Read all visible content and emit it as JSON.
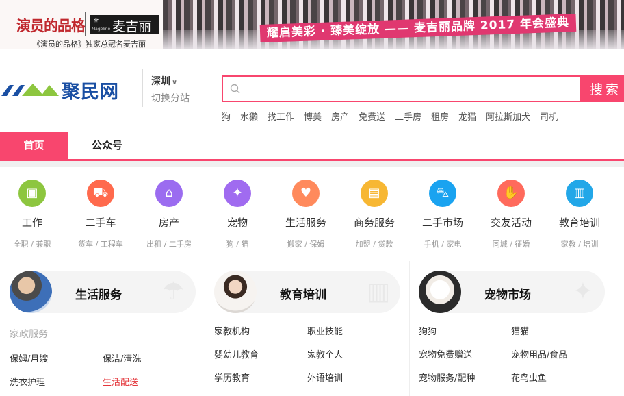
{
  "banner": {
    "brand_left": "演员的品格",
    "brand_right": "麦吉丽",
    "brand_right_small": "Mageline",
    "caption": "《演员的品格》独家总冠名麦吉丽",
    "slogan": "耀启美彩 · 臻美绽放 —— 麦吉丽品牌 2017 年会盛典"
  },
  "header": {
    "logo_text": "聚民网",
    "city": "深圳",
    "city_switch": "切换分站",
    "search_placeholder": "",
    "search_button": "搜索",
    "hot_words": [
      "狗",
      "水獭",
      "找工作",
      "博美",
      "房产",
      "免费送",
      "二手房",
      "租房",
      "龙猫",
      "阿拉斯加犬",
      "司机"
    ]
  },
  "nav": {
    "home": "首页",
    "official": "公众号"
  },
  "categories": [
    {
      "title": "工作",
      "sub": "全职 / 兼职",
      "color": "#8dc63f",
      "icon": "briefcase-icon"
    },
    {
      "title": "二手车",
      "sub": "货车 / 工程车",
      "color": "#ff6a4d",
      "icon": "car-icon"
    },
    {
      "title": "房产",
      "sub": "出租 / 二手房",
      "color": "#9b6cf0",
      "icon": "house-icon"
    },
    {
      "title": "宠物",
      "sub": "狗 / 猫",
      "color": "#a06bf0",
      "icon": "dog-icon"
    },
    {
      "title": "生活服务",
      "sub": "搬家 / 保姆",
      "color": "#ff8a5c",
      "icon": "heart-hand-icon"
    },
    {
      "title": "商务服务",
      "sub": "加盟 / 贷款",
      "color": "#f7b733",
      "icon": "shop-icon"
    },
    {
      "title": "二手市场",
      "sub": "手机 / 家电",
      "color": "#1aa3f0",
      "icon": "cart-icon"
    },
    {
      "title": "交友活动",
      "sub": "同城 / 征婚",
      "color": "#ff6a5c",
      "icon": "handshake-icon"
    },
    {
      "title": "教育培训",
      "sub": "家教 / 培训",
      "color": "#22a7e8",
      "icon": "book-icon"
    }
  ],
  "sections": [
    {
      "title": "生活服务",
      "sub": "家政服务",
      "links": [
        "保姆/月嫂",
        "保洁/清洗",
        "洗衣护理",
        "生活配送"
      ],
      "highlight": "生活配送"
    },
    {
      "title": "教育培训",
      "links": [
        "家教机构",
        "职业技能",
        "婴幼儿教育",
        "家教个人",
        "学历教育",
        "外语培训"
      ]
    },
    {
      "title": "宠物市场",
      "links": [
        "狗狗",
        "猫猫",
        "宠物免费赠送",
        "宠物用品/食品",
        "宠物服务/配种",
        "花鸟虫鱼"
      ]
    }
  ]
}
